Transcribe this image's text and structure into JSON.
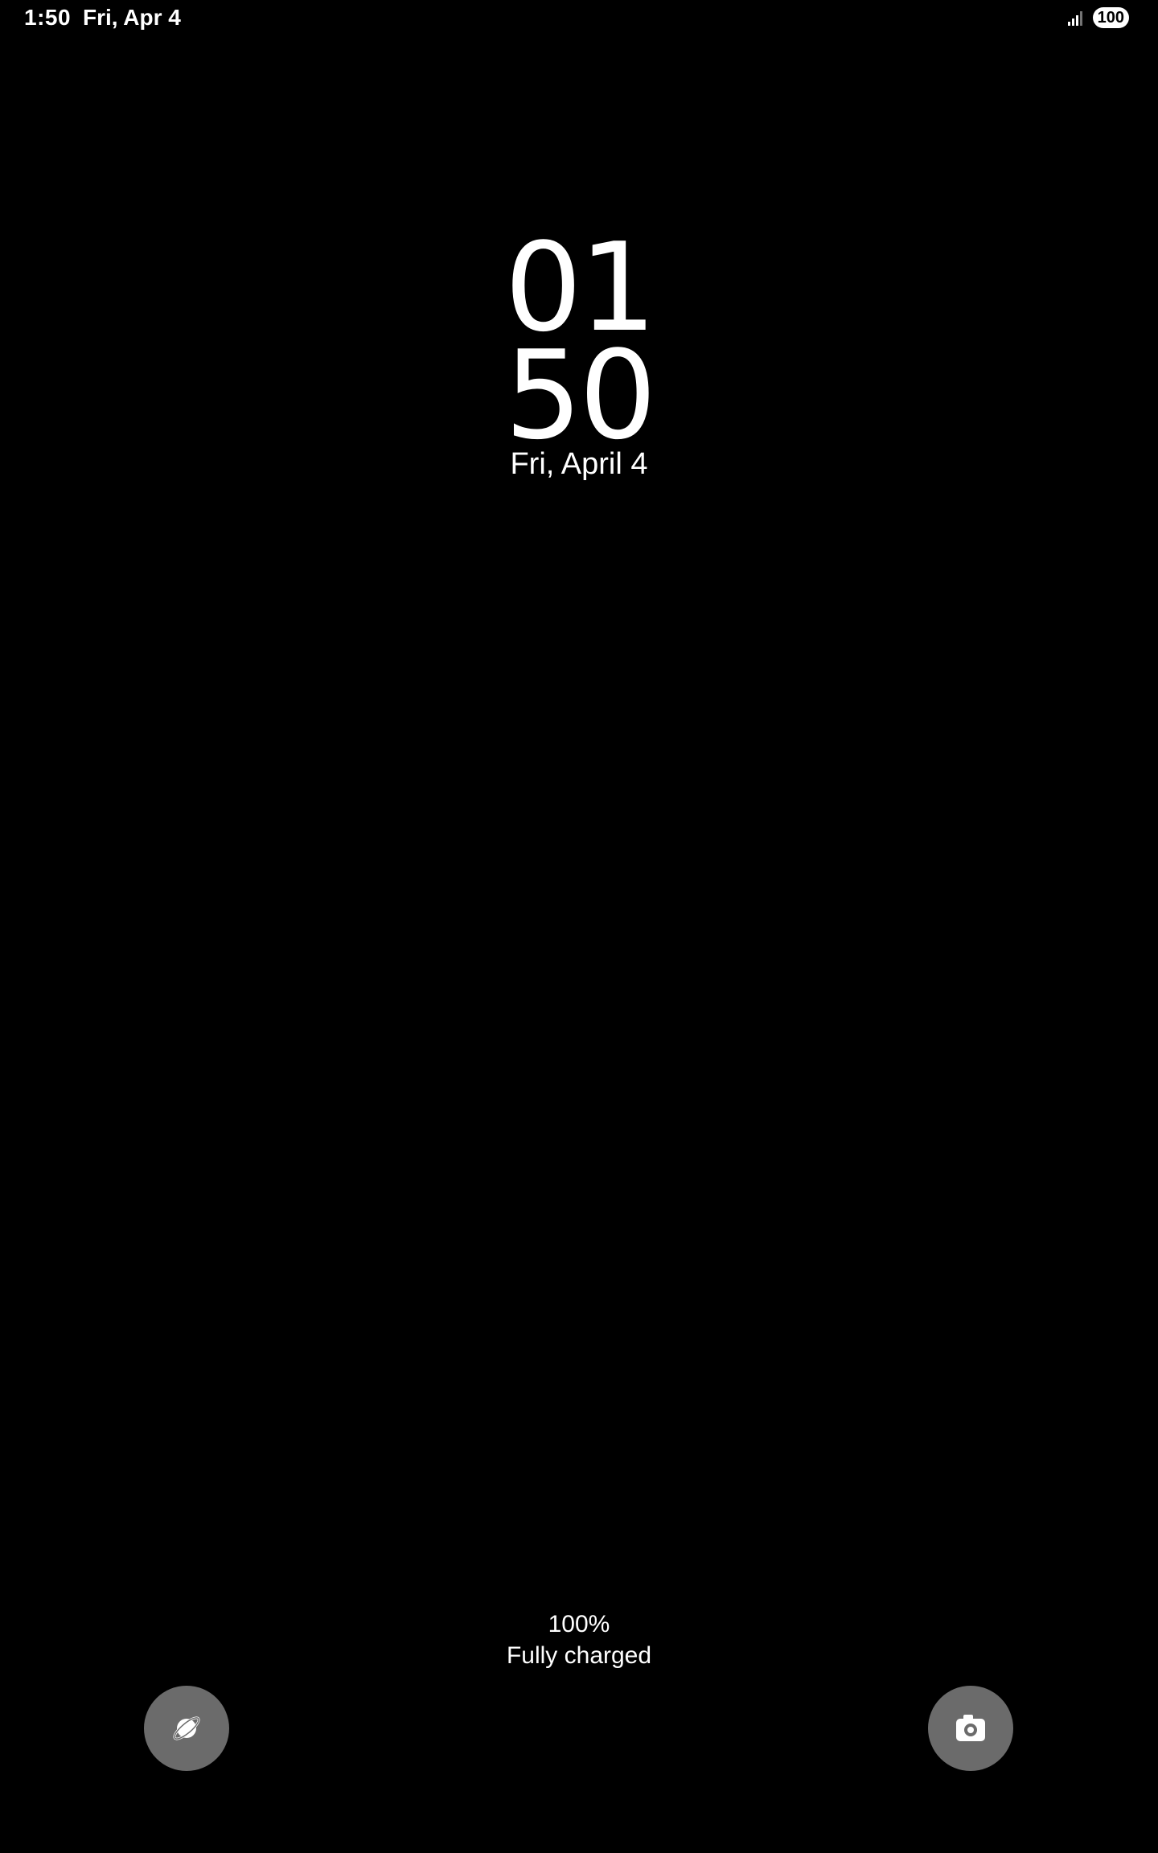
{
  "status_bar": {
    "time": "1:50",
    "date": "Fri, Apr 4",
    "signal_icon": "signal-bars-icon",
    "battery_level": "100"
  },
  "clock": {
    "hours": "01",
    "minutes": "50",
    "date": "Fri, April 4"
  },
  "charging": {
    "percent": "100%",
    "status": "Fully charged"
  },
  "shortcuts": {
    "left_icon": "planet-icon",
    "right_icon": "camera-icon"
  },
  "colors": {
    "background": "#000000",
    "text": "#ffffff",
    "shortcut_bg": "#6b6b6b"
  }
}
